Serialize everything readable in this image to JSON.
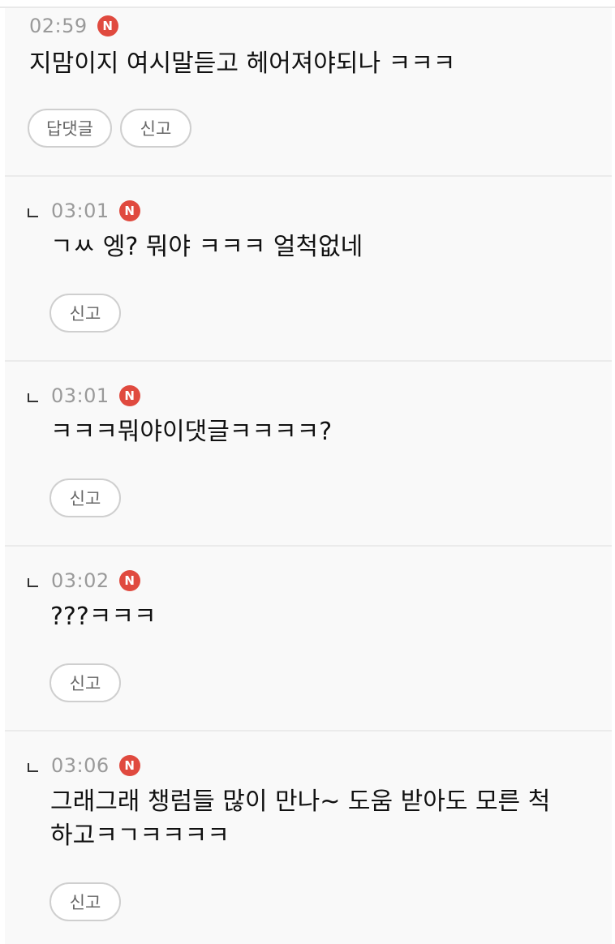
{
  "comments": [
    {
      "time": "02:59",
      "badge": "N",
      "text": "지맘이지 여시말듣고 헤어져야되나 ㅋㅋㅋ",
      "reply_label": "답댓글",
      "report_label": "신고"
    },
    {
      "time": "03:01",
      "badge": "N",
      "text": "ㄱㅆ 엥? 뭐야 ㅋㅋㅋ 얼척없네",
      "report_label": "신고"
    },
    {
      "time": "03:01",
      "badge": "N",
      "text": "ㅋㅋㅋ뭐야이댓글ㅋㅋㅋㅋ?",
      "report_label": "신고"
    },
    {
      "time": "03:02",
      "badge": "N",
      "text": "???ㅋㅋㅋ",
      "report_label": "신고"
    },
    {
      "time": "03:06",
      "badge": "N",
      "text_line1": "그래그래 챙럼들 많이 만나~ 도움 받아도 모른 척",
      "text_line2": "하고ㅋㄱㅋㅋㅋㅋ",
      "report_label": "신고"
    }
  ],
  "colors": {
    "badge": "#e04a3f",
    "time": "#9a9a9a",
    "background": "#f9f9f9"
  }
}
